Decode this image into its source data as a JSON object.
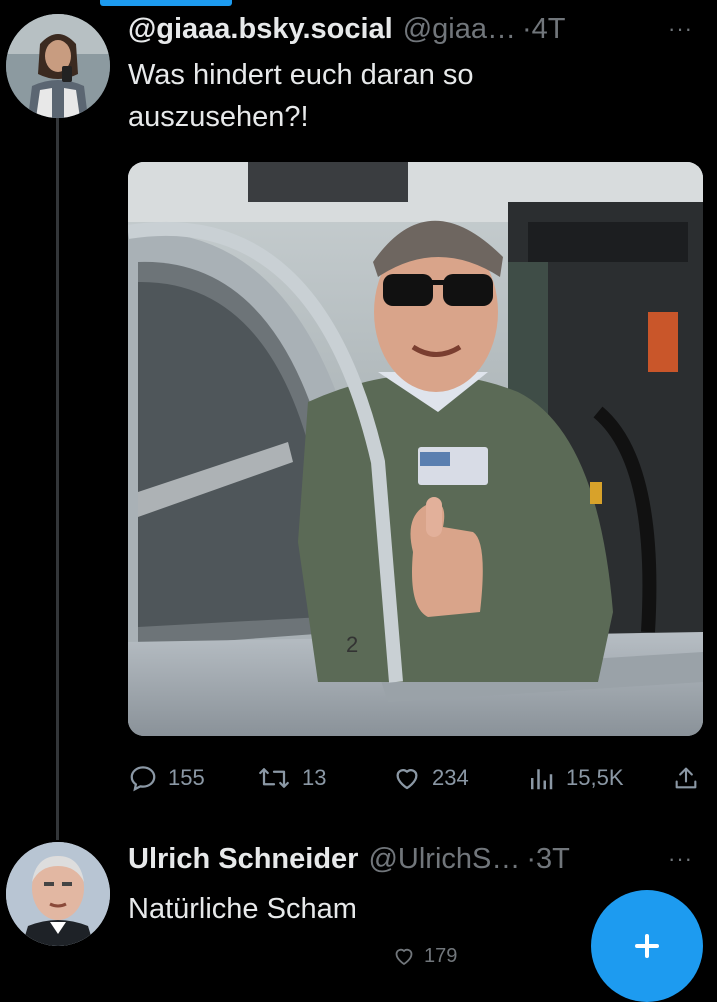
{
  "thread": {
    "post1": {
      "display_name": "@giaaa.bsky.social",
      "handle": "@giaa…",
      "separator": "·",
      "time": "4T",
      "more_label": "···",
      "text_line1": "Was hindert euch daran so",
      "text_line2": "auszusehen?!",
      "image_icon": "photo-pilot-in-cockpit",
      "actions": {
        "replies": "155",
        "reposts": "13",
        "likes": "234",
        "views": "15,5K"
      }
    },
    "post2": {
      "display_name": "Ulrich Schneider",
      "handle": "@UlrichS…",
      "separator": "·",
      "time": "3T",
      "more_label": "···",
      "text": "Natürliche Scham",
      "actions": {
        "likes": "179"
      }
    }
  },
  "colors": {
    "background": "#000000",
    "accent": "#1d9bf0",
    "muted_text": "#71767b",
    "primary_text": "#e7e9ea"
  }
}
